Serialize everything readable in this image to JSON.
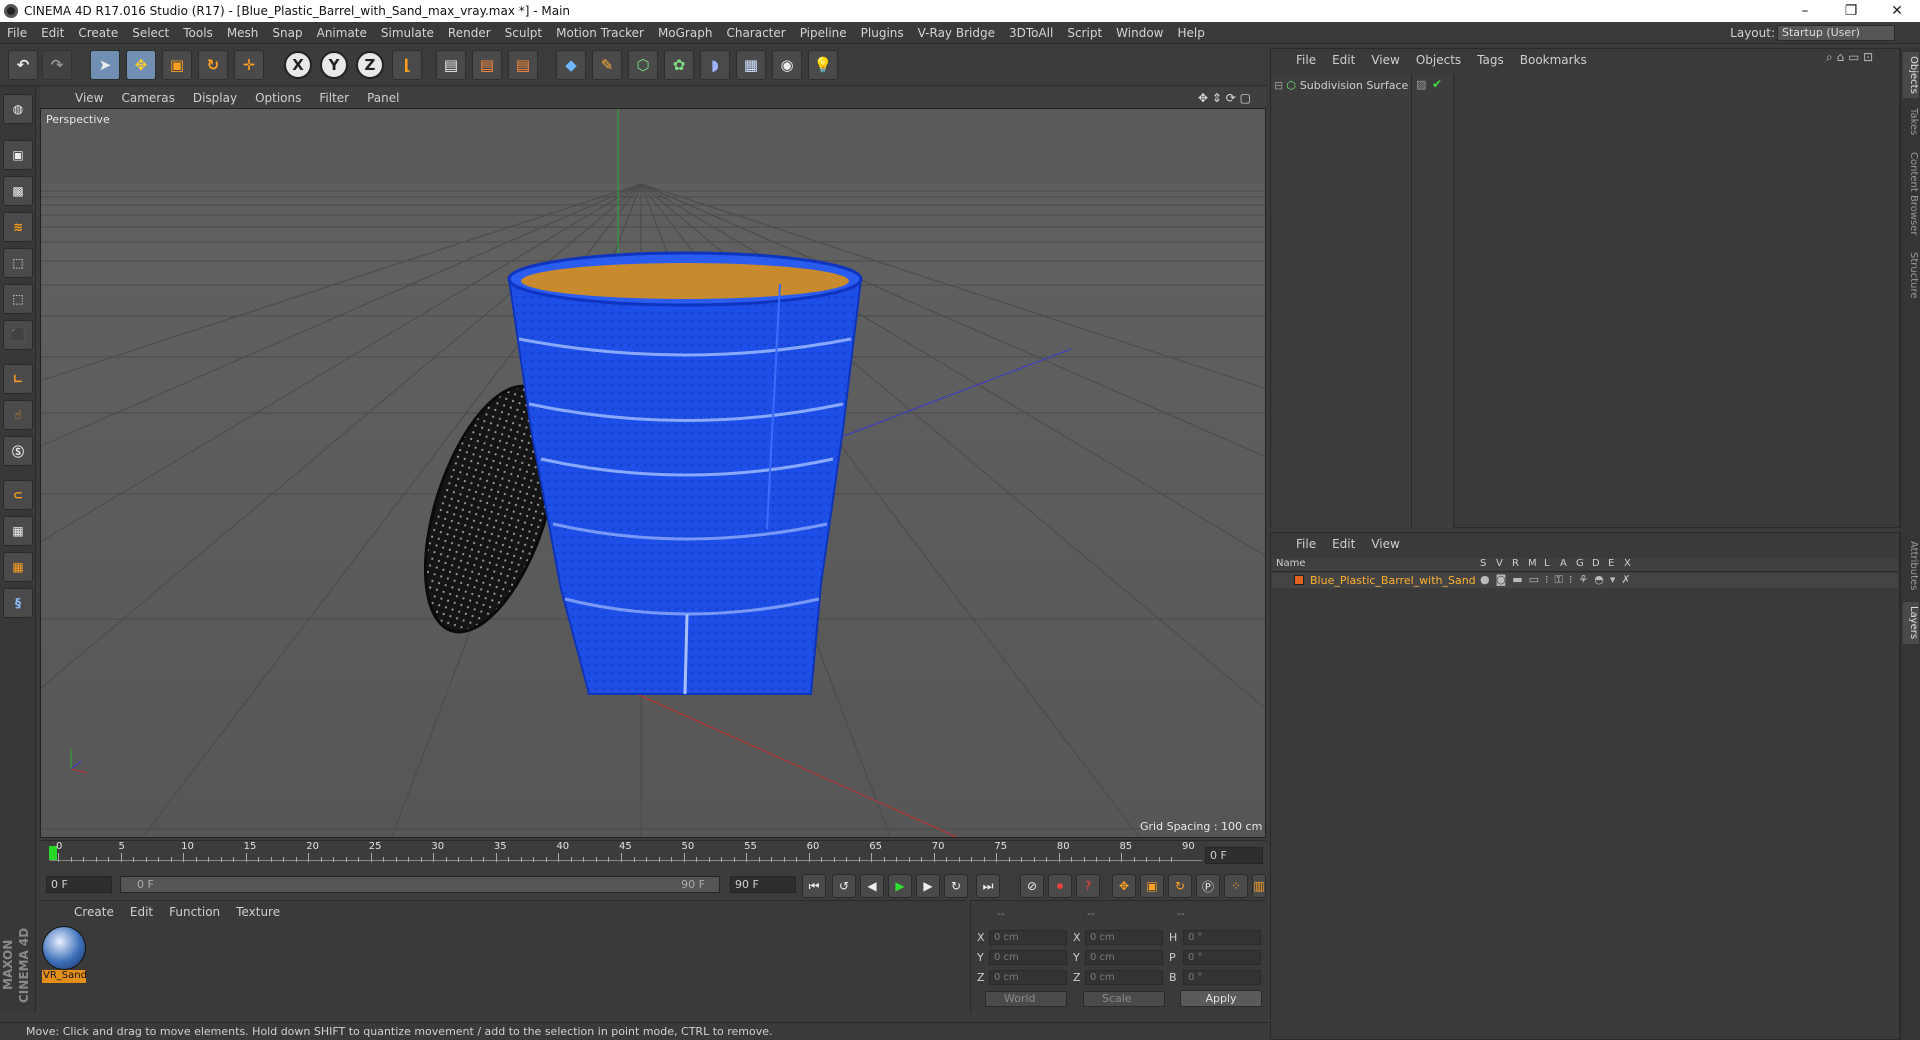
{
  "window": {
    "title": "CINEMA 4D R17.016 Studio (R17) - [Blue_Plastic_Barrel_with_Sand_max_vray.max *] - Main",
    "minimize": "–",
    "maximize": "❐",
    "close": "✕"
  },
  "menubar": {
    "items": [
      "File",
      "Edit",
      "Create",
      "Select",
      "Tools",
      "Mesh",
      "Snap",
      "Animate",
      "Simulate",
      "Render",
      "Sculpt",
      "Motion Tracker",
      "MoGraph",
      "Character",
      "Pipeline",
      "Plugins",
      "V-Ray Bridge",
      "3DToAll",
      "Script",
      "Window",
      "Help"
    ],
    "layout_label": "Layout:",
    "layout_value": "Startup (User)"
  },
  "toolbar": {
    "axis_x": "X",
    "axis_y": "Y",
    "axis_z": "Z"
  },
  "viewport": {
    "menu": [
      "View",
      "Cameras",
      "Display",
      "Options",
      "Filter",
      "Panel"
    ],
    "label": "Perspective",
    "grid_spacing": "Grid Spacing : 100 cm"
  },
  "timeline": {
    "ticks": [
      "0",
      "5",
      "10",
      "15",
      "20",
      "25",
      "30",
      "35",
      "40",
      "45",
      "50",
      "55",
      "60",
      "65",
      "70",
      "75",
      "80",
      "85",
      "90"
    ],
    "current_frame_right": "0 F",
    "start_field": "0 F",
    "range_start": "0 F",
    "range_end": "90 F",
    "end_field": "90 F"
  },
  "material_manager": {
    "menu": [
      "Create",
      "Edit",
      "Function",
      "Texture"
    ],
    "material_name": "VR_Sand"
  },
  "coordinates": {
    "header": [
      "--",
      "--",
      "--"
    ],
    "rows": [
      {
        "axis": "X",
        "pos": "0 cm",
        "axis2": "X",
        "size": "0 cm",
        "rot_label": "H",
        "rot": "0 °"
      },
      {
        "axis": "Y",
        "pos": "0 cm",
        "axis2": "Y",
        "size": "0 cm",
        "rot_label": "P",
        "rot": "0 °"
      },
      {
        "axis": "Z",
        "pos": "0 cm",
        "axis2": "Z",
        "size": "0 cm",
        "rot_label": "B",
        "rot": "0 °"
      }
    ],
    "world_dropdown": "World",
    "scale_dropdown": "Scale",
    "apply": "Apply"
  },
  "status": {
    "text": "Move: Click and drag to move elements. Hold down SHIFT to quantize movement / add to the selection in point mode, CTRL to remove."
  },
  "object_manager": {
    "menu": [
      "File",
      "Edit",
      "View",
      "Objects",
      "Tags",
      "Bookmarks"
    ],
    "objects": [
      {
        "name": "Subdivision Surface"
      }
    ]
  },
  "layer_manager": {
    "menu": [
      "File",
      "Edit",
      "View"
    ],
    "columns": [
      "Name",
      "S",
      "V",
      "R",
      "M",
      "L",
      "A",
      "G",
      "D",
      "E",
      "X"
    ],
    "layers": [
      {
        "name": "Blue_Plastic_Barrel_with_Sand",
        "color": "#e0631f"
      }
    ]
  },
  "right_tabs": [
    "Objects",
    "Takes",
    "Content Browser",
    "Structure",
    "Attributes",
    "Layers"
  ],
  "colors": {
    "barrel": "#1d4fe8",
    "sand": "#c98a2e",
    "accent_orange": "#e58f1b"
  }
}
